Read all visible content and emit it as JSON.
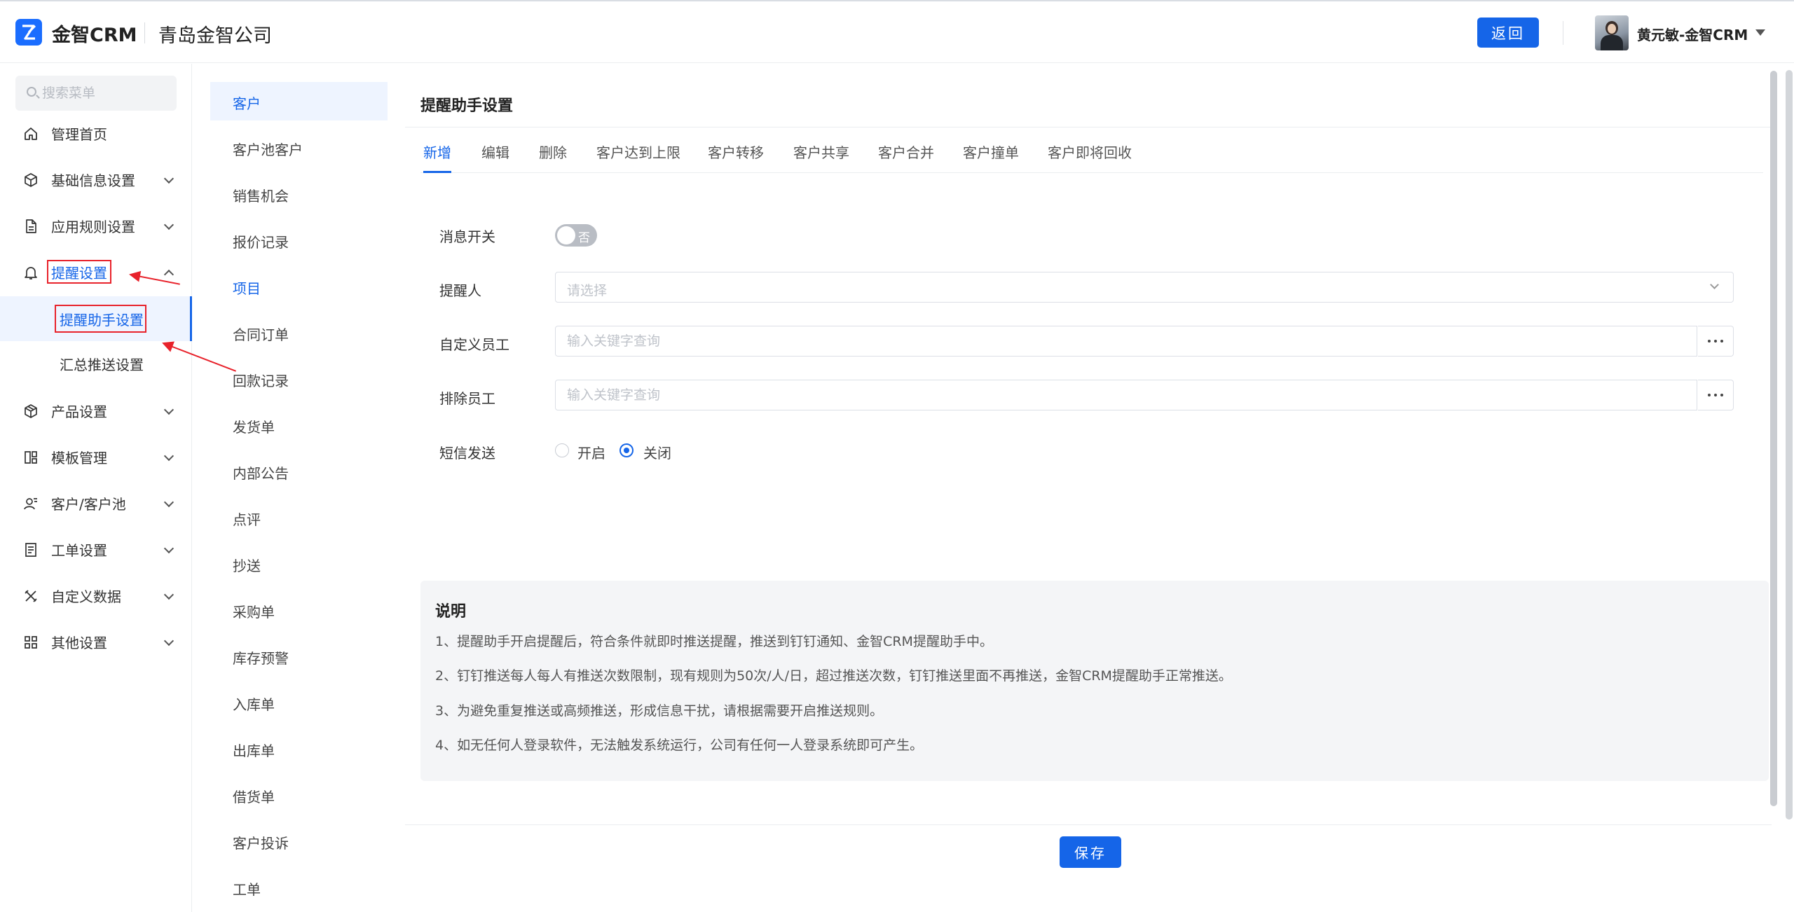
{
  "header": {
    "brand": "金智CRM",
    "company": "青岛金智公司",
    "back_label": "返回",
    "username": "黄元敏-金智CRM"
  },
  "sidebar": {
    "search_placeholder": "搜索菜单",
    "items": [
      {
        "label": "管理首页",
        "icon": "home-icon"
      },
      {
        "label": "基础信息设置",
        "icon": "cube-icon"
      },
      {
        "label": "应用规则设置",
        "icon": "document-icon"
      },
      {
        "label": "提醒设置",
        "icon": "bell-icon",
        "expanded": true
      },
      {
        "label": "产品设置",
        "icon": "box-icon"
      },
      {
        "label": "模板管理",
        "icon": "template-icon"
      },
      {
        "label": "客户/客户池",
        "icon": "user-card-icon"
      },
      {
        "label": "工单设置",
        "icon": "ticket-icon"
      },
      {
        "label": "自定义数据",
        "icon": "tools-icon"
      },
      {
        "label": "其他设置",
        "icon": "grid-icon"
      }
    ],
    "sub_items": [
      {
        "label": "提醒助手设置",
        "active": true
      },
      {
        "label": "汇总推送设置",
        "active": false
      }
    ]
  },
  "subnav": {
    "items": [
      "客户",
      "客户池客户",
      "销售机会",
      "报价记录",
      "项目",
      "合同订单",
      "回款记录",
      "发货单",
      "内部公告",
      "点评",
      "抄送",
      "采购单",
      "库存预警",
      "入库单",
      "出库单",
      "借货单",
      "客户投诉",
      "工单"
    ],
    "active_index": 0,
    "highlight_index": 4
  },
  "main": {
    "title": "提醒助手设置",
    "tabs": [
      "新增",
      "编辑",
      "删除",
      "客户达到上限",
      "客户转移",
      "客户共享",
      "客户合并",
      "客户撞单",
      "客户即将回收"
    ],
    "active_tab": 0,
    "form": {
      "message_switch_label": "消息开关",
      "message_switch_value": "否",
      "reminder_label": "提醒人",
      "reminder_placeholder": "请选择",
      "custom_staff_label": "自定义员工",
      "custom_staff_placeholder": "输入关键字查询",
      "exclude_staff_label": "排除员工",
      "exclude_staff_placeholder": "输入关键字查询",
      "sms_label": "短信发送",
      "sms_on_label": "开启",
      "sms_off_label": "关闭",
      "sms_selected": "关闭"
    },
    "notes": {
      "title": "说明",
      "lines": [
        "1、提醒助手开启提醒后，符合条件就即时推送提醒，推送到钉钉通知、金智CRM提醒助手中。",
        "2、钉钉推送每人每人有推送次数限制，现有规则为50次/人/日，超过推送次数，钉钉推送里面不再推送，金智CRM提醒助手正常推送。",
        "3、为避免重复推送或高频推送，形成信息干扰，请根据需要开启推送规则。",
        "4、如无任何人登录软件，无法触发系统运行，公司有任何一人登录系统即可产生。"
      ]
    },
    "save_label": "保存"
  },
  "colors": {
    "primary": "#1565e8",
    "annotation_red": "#e8222b"
  }
}
